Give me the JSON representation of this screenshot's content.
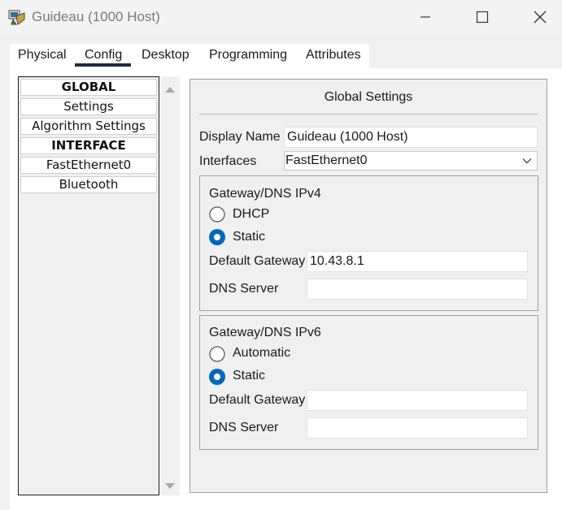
{
  "window": {
    "title": "Guideau (1000 Host)"
  },
  "tabs": [
    {
      "label": "Physical"
    },
    {
      "label": "Config",
      "active": true
    },
    {
      "label": "Desktop"
    },
    {
      "label": "Programming"
    },
    {
      "label": "Attributes"
    }
  ],
  "sidebar": {
    "items": [
      {
        "label": "GLOBAL",
        "bold": true
      },
      {
        "label": "Settings"
      },
      {
        "label": "Algorithm Settings"
      },
      {
        "label": "INTERFACE",
        "bold": true
      },
      {
        "label": "FastEthernet0"
      },
      {
        "label": "Bluetooth"
      }
    ]
  },
  "panel": {
    "title": "Global Settings",
    "display_name_label": "Display Name",
    "display_name_value": "Guideau (1000 Host)",
    "interfaces_label": "Interfaces",
    "interfaces_value": "FastEthernet0"
  },
  "ipv4": {
    "title": "Gateway/DNS IPv4",
    "option1": "DHCP",
    "option2": "Static",
    "selected": "Static",
    "gateway_label": "Default Gateway",
    "gateway_value": "10.43.8.1",
    "dns_label": "DNS Server",
    "dns_value": ""
  },
  "ipv6": {
    "title": "Gateway/DNS IPv6",
    "option1": "Automatic",
    "option2": "Static",
    "selected": "Static",
    "gateway_label": "Default Gateway",
    "gateway_value": "",
    "dns_label": "DNS Server",
    "dns_value": ""
  },
  "colors": {
    "radio_selected": "#0067c0",
    "tab_underline": "#1e2d3d"
  },
  "icons": {
    "app": "packet-tracer-pc-icon",
    "minimize": "minimize-icon",
    "maximize": "maximize-icon",
    "close": "close-icon",
    "scroll_up": "scroll-up-arrow-icon",
    "scroll_down": "scroll-down-arrow-icon",
    "dropdown": "chevron-down-icon"
  }
}
